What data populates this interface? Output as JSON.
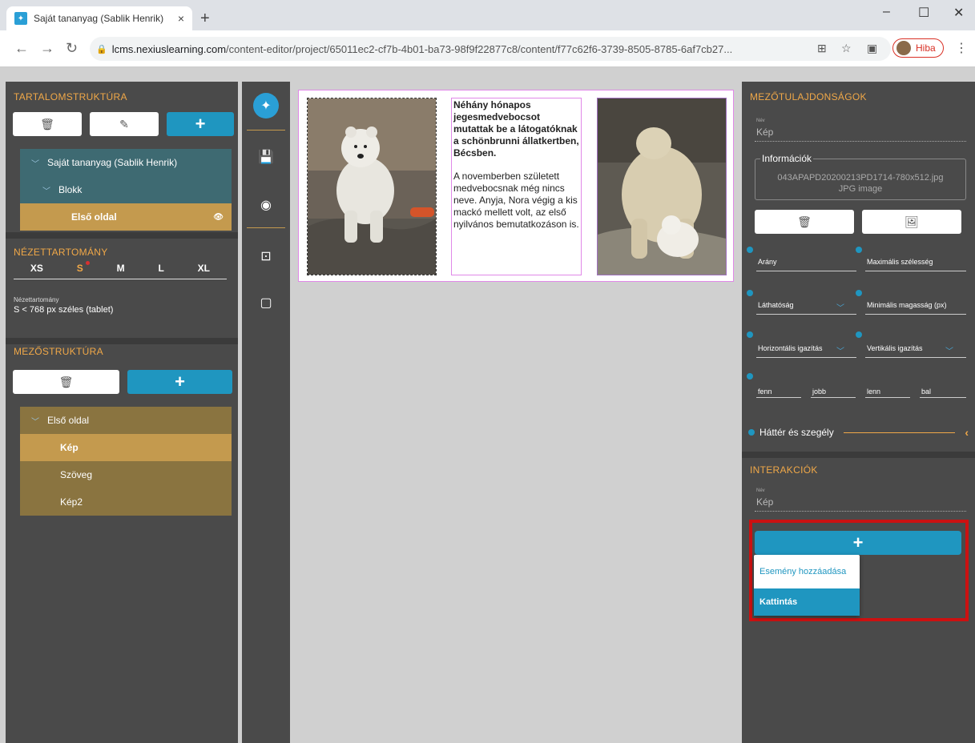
{
  "browser": {
    "tab_title": "Saját tananyag (Sablik Henrik)",
    "tab_close": "×",
    "new_tab": "+",
    "url_host": "lcms.nexiuslearning.com",
    "url_path": "/content-editor/project/65011ec2-cf7b-4b01-ba73-98f9f22877c8/content/f77c62f6-3739-8505-8785-6af7cb27...",
    "profile_label": "Hiba",
    "minimize": "–",
    "maximize": "☐",
    "close": "✕"
  },
  "left": {
    "content_structure_title": "TARTALOMSTRUKTÚRA",
    "tree": [
      {
        "label": "Saját tananyag (Sablik Henrik)"
      },
      {
        "label": "Blokk"
      },
      {
        "label": "Első oldal"
      }
    ],
    "viewport_title": "NÉZETTARTOMÁNY",
    "sizes": [
      "XS",
      "S",
      "M",
      "L",
      "XL"
    ],
    "viewport_label": "Nézettartomány",
    "viewport_value": "S < 768 px széles (tablet)",
    "field_structure_title": "MEZŐSTRUKTÚRA",
    "fields": [
      {
        "label": "Első oldal"
      },
      {
        "label": "Kép"
      },
      {
        "label": "Szöveg"
      },
      {
        "label": "Kép2"
      }
    ]
  },
  "canvas": {
    "heading": "Néhány hónapos jegesmedvebocsot mutattak be a látogatóknak a schönbrunni állatkertben, Bécsben.",
    "body": "A novemberben született medvebocsnak még nincs neve. Anyja, Nora végig a kis mackó mellett volt, az első nyilvános bemutatkozáson is."
  },
  "right": {
    "props_title": "MEZŐTULAJDONSÁGOK",
    "name_label": "Név",
    "name_value": "Kép",
    "info_legend": "Információk",
    "info_file": "043APAPD20200213PD1714-780x512.jpg",
    "info_type": "JPG image",
    "ratio": "Arány",
    "max_width": "Maximális szélesség",
    "visibility": "Láthatóság",
    "min_height": "Minimális magasság (px)",
    "h_align": "Horizontális igazítás",
    "v_align": "Vertikális igazítás",
    "top": "fenn",
    "right_m": "jobb",
    "bottom": "lenn",
    "left_m": "bal",
    "bg_border": "Háttér és szegély",
    "interactions_title": "INTERAKCIÓK",
    "int_name_label": "Név",
    "int_name_value": "Kép",
    "dropdown_add_event": "Esemény hozzáadása",
    "dropdown_click": "Kattintás"
  }
}
